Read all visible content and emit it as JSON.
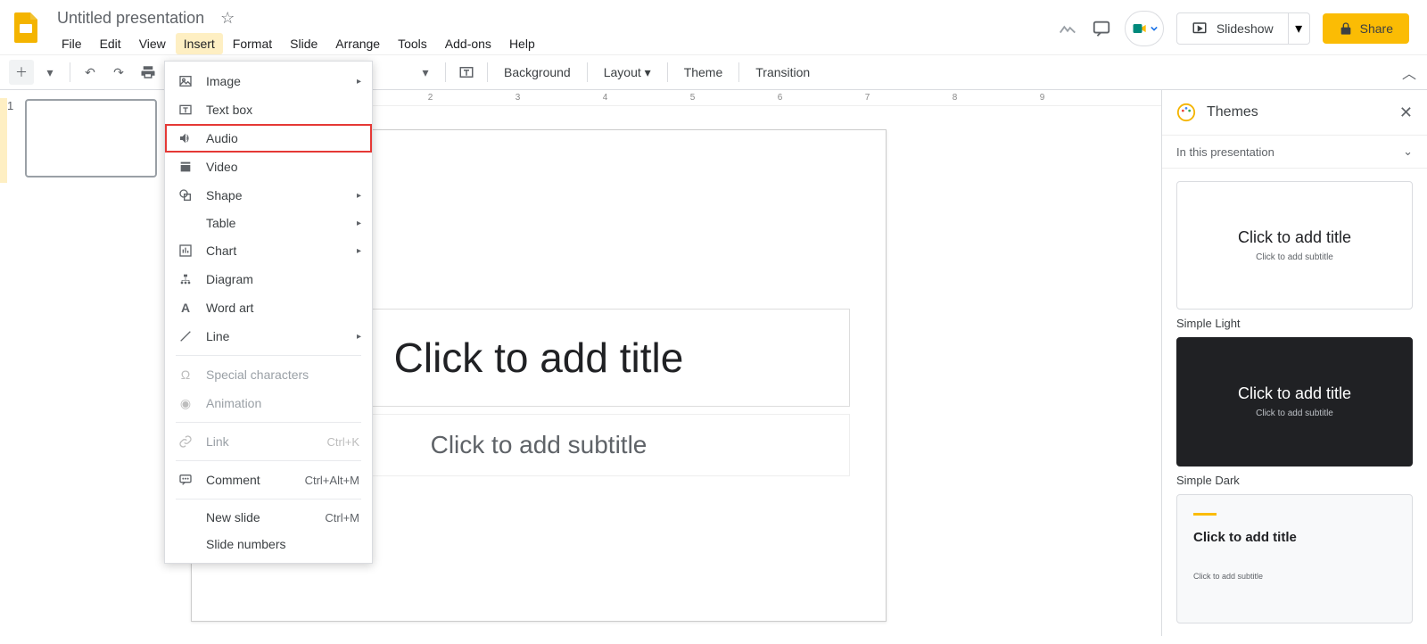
{
  "header": {
    "doc_title": "Untitled presentation",
    "menus": [
      "File",
      "Edit",
      "View",
      "Insert",
      "Format",
      "Slide",
      "Arrange",
      "Tools",
      "Add-ons",
      "Help"
    ],
    "active_menu_index": 3,
    "slideshow_label": "Slideshow",
    "share_label": "Share"
  },
  "toolbar": {
    "background": "Background",
    "layout": "Layout",
    "theme": "Theme",
    "transition": "Transition"
  },
  "ruler_marks": [
    "2",
    "3",
    "4",
    "5",
    "6",
    "7",
    "8",
    "9"
  ],
  "filmstrip": {
    "slide_number": "1"
  },
  "slide": {
    "title_placeholder": "Click to add title",
    "subtitle_placeholder": "Click to add subtitle"
  },
  "themes_panel": {
    "title": "Themes",
    "subtitle": "In this presentation",
    "card_title": "Click to add title",
    "card_sub": "Click to add subtitle",
    "name_light": "Simple Light",
    "name_dark": "Simple Dark"
  },
  "insert_menu": {
    "image": "Image",
    "textbox": "Text box",
    "audio": "Audio",
    "video": "Video",
    "shape": "Shape",
    "table": "Table",
    "chart": "Chart",
    "diagram": "Diagram",
    "wordart": "Word art",
    "line": "Line",
    "special": "Special characters",
    "animation": "Animation",
    "link": "Link",
    "link_sc": "Ctrl+K",
    "comment": "Comment",
    "comment_sc": "Ctrl+Alt+M",
    "newslide": "New slide",
    "newslide_sc": "Ctrl+M",
    "slidenumbers": "Slide numbers"
  }
}
